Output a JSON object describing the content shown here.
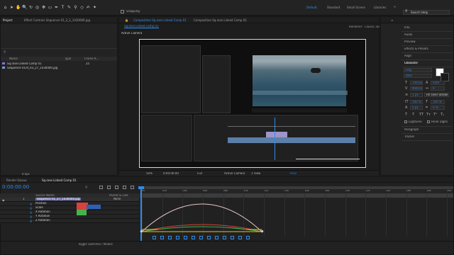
{
  "toolbar": {
    "tools": [
      {
        "icon": "home-icon",
        "glyph": "⌂"
      },
      {
        "icon": "selection-arrow-icon",
        "glyph": "➤"
      },
      {
        "icon": "hand-icon",
        "glyph": "✋"
      },
      {
        "icon": "zoom-icon",
        "glyph": "🔍"
      },
      {
        "icon": "rotate-icon",
        "glyph": "↻"
      },
      {
        "icon": "camera-orbit-icon",
        "glyph": "◎"
      },
      {
        "icon": "pan-behind-icon",
        "glyph": "✥"
      },
      {
        "icon": "rectangle-mask-icon",
        "glyph": "▭"
      },
      {
        "icon": "pen-icon",
        "glyph": "✒"
      },
      {
        "icon": "type-icon",
        "glyph": "T"
      },
      {
        "icon": "brush-icon",
        "glyph": "✎"
      },
      {
        "icon": "clone-stamp-icon",
        "glyph": "⚲"
      },
      {
        "icon": "eraser-icon",
        "glyph": "◇"
      },
      {
        "icon": "roto-brush-icon",
        "glyph": "✍"
      },
      {
        "icon": "puppet-pin-icon",
        "glyph": "✦"
      }
    ],
    "snapping_label": "Snapping",
    "workspaces": [
      "Default",
      "Standard",
      "Small Screen",
      "Libraries"
    ],
    "search_placeholder": "Search Help"
  },
  "project_panel": {
    "tab_project": "Project",
    "tab_effect_controls": "Effect Controls Sequence 01_2_2_1430000.jpg",
    "columns": [
      "Name",
      "Type",
      "Frame R..."
    ],
    "items": [
      {
        "name": "Sq.rose Linked Comp 01",
        "fps": "25"
      },
      {
        "name": "Sequence 01/0_03_27_1430000.jpg",
        "fps": ""
      }
    ],
    "footer_bpc": "8 bpc"
  },
  "composition_panel": {
    "tab_comp": "Composition Sq.rose Linked Comp 01",
    "tab_comp2": "Composition Sq.rose Linked Comp 01",
    "breadcrumb": "Sq.rose Linked Comp 01",
    "active_camera_label": "Active Camera",
    "renderer_label": "Renderer:",
    "renderer_value": "Classic 3D",
    "zoom": "50%",
    "timecode": "0:00:00:00",
    "resolution": "Full",
    "camera": "Active Camera",
    "views": "1 View",
    "exposure": "+0.0"
  },
  "right_panel": {
    "sections": [
      "Info",
      "Audio",
      "Preview",
      "Effects & Presets",
      "Align",
      "Libraries"
    ],
    "character_title": "Character",
    "font_family": "Gog",
    "font_style": "Bold",
    "font_size": "139 px",
    "leading": "Auto",
    "kerning": "Metrics",
    "tracking": "0",
    "stroke_width": "1 px",
    "stroke_type": "Fill Over Stroke",
    "vertical_scale": "100 %",
    "horizontal_scale": "100 %",
    "baseline_shift": "0 px",
    "tsume": "0 %",
    "ligatures_label": "Ligatures",
    "hindi_digits_label": "Hindi Digits",
    "paragraph_label": "Paragraph",
    "tracker_label": "Tracker"
  },
  "timeline": {
    "tab_render_queue": "Render Queue",
    "tab_comp": "Sq.rose Linked Comp 01",
    "current_time": "0:00:00:00",
    "columns": [
      "Source Name",
      "Parent & Link"
    ],
    "layers": [
      {
        "index": "1",
        "name": "Sequence 01_27_1430000.jpg",
        "parent": "None"
      },
      {
        "index": "",
        "name": "Position",
        "parent": ""
      },
      {
        "index": "",
        "name": "Scale",
        "parent": ""
      },
      {
        "index": "",
        "name": "X Rotation",
        "parent": ""
      },
      {
        "index": "",
        "name": "Y Rotation",
        "parent": ""
      },
      {
        "index": "",
        "name": "Z Rotation",
        "parent": ""
      }
    ],
    "ruler_labels": [
      "0s",
      "02s",
      "04s",
      "06s",
      "08s",
      "10s",
      "12s",
      "14s",
      "16s",
      "18s",
      "20s",
      "22s",
      "24s",
      "26s",
      "28s",
      "30s"
    ],
    "toggle_label": "Toggle Switches / Modes",
    "accent_color": "#2d8ceb"
  }
}
